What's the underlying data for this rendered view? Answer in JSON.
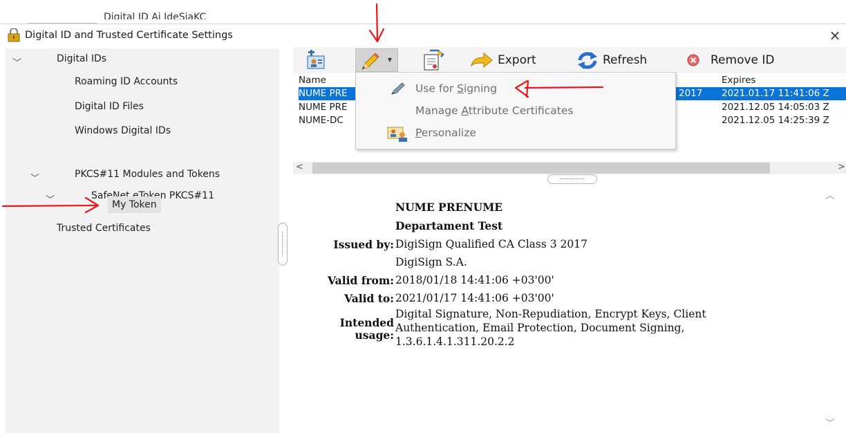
{
  "background_fragment": "Digital ID Ai IdeSiaKC",
  "window": {
    "title": "Digital ID and Trusted Certificate Settings",
    "close_icon": "×"
  },
  "sidebar": {
    "items": [
      {
        "label": "Digital IDs",
        "expanded": true
      },
      {
        "label": "Roaming ID Accounts"
      },
      {
        "label": "Digital ID Files"
      },
      {
        "label": "Windows Digital IDs"
      },
      {
        "label": "PKCS#11 Modules and Tokens",
        "expanded": true
      },
      {
        "label": "SafeNet eToken PKCS#11",
        "expanded": true
      },
      {
        "label": "My Token",
        "selected": true
      },
      {
        "label": "Trusted Certificates"
      }
    ],
    "chevron": "﹀"
  },
  "toolbar": {
    "add_icon": "add-id-icon",
    "sign_icon": "pencil-icon",
    "dropdown_arrow": "▾",
    "certificate_icon": "certificate-icon",
    "export_label": "Export",
    "refresh_label": "Refresh",
    "remove_label": "Remove ID"
  },
  "list": {
    "columns": {
      "name": "Name",
      "expires": "Expires"
    },
    "rows": [
      {
        "name": "NUME PRE",
        "mid": "2017",
        "expires": "2021.01.17 11:41:06 Z",
        "selected": true
      },
      {
        "name": "NUME PRE",
        "mid": "",
        "expires": "2021.12.05 14:05:03 Z"
      },
      {
        "name": "NUME-DC",
        "mid": "",
        "expires": "2021.12.05 14:25:39 Z"
      }
    ]
  },
  "menu": {
    "items": [
      {
        "pre": "Use for ",
        "u": "S",
        "post": "igning"
      },
      {
        "pre": "Manage ",
        "u": "A",
        "post": "ttribute Certificates"
      },
      {
        "pre": "",
        "u": "P",
        "post": "ersonalize"
      }
    ]
  },
  "details": {
    "name": "NUME PRENUME",
    "org_unit": "Departament Test",
    "issued_by_label": "Issued by:",
    "issued_by": "DigiSign Qualified CA Class 3 2017",
    "issuer_org": "DigiSign S.A.",
    "valid_from_label": "Valid from:",
    "valid_from": "2018/01/18 14:41:06 +03'00'",
    "valid_to_label": "Valid to:",
    "valid_to": "2021/01/17 14:41:06 +03'00'",
    "intended_label_1": "Intended",
    "intended_label_2": "usage:",
    "intended_line_1": "Digital Signature, Non-Repudiation, Encrypt Keys, Client",
    "intended_line_2": "Authentication, Email Protection, Document Signing,",
    "intended_line_3": "1.3.6.1.4.1.311.20.2.2"
  },
  "scroll": {
    "left": "<",
    "right": ">",
    "up": "︿",
    "down": "﹀"
  },
  "colors": {
    "selection": "#0a74d8",
    "annotation": "#e8141a"
  }
}
